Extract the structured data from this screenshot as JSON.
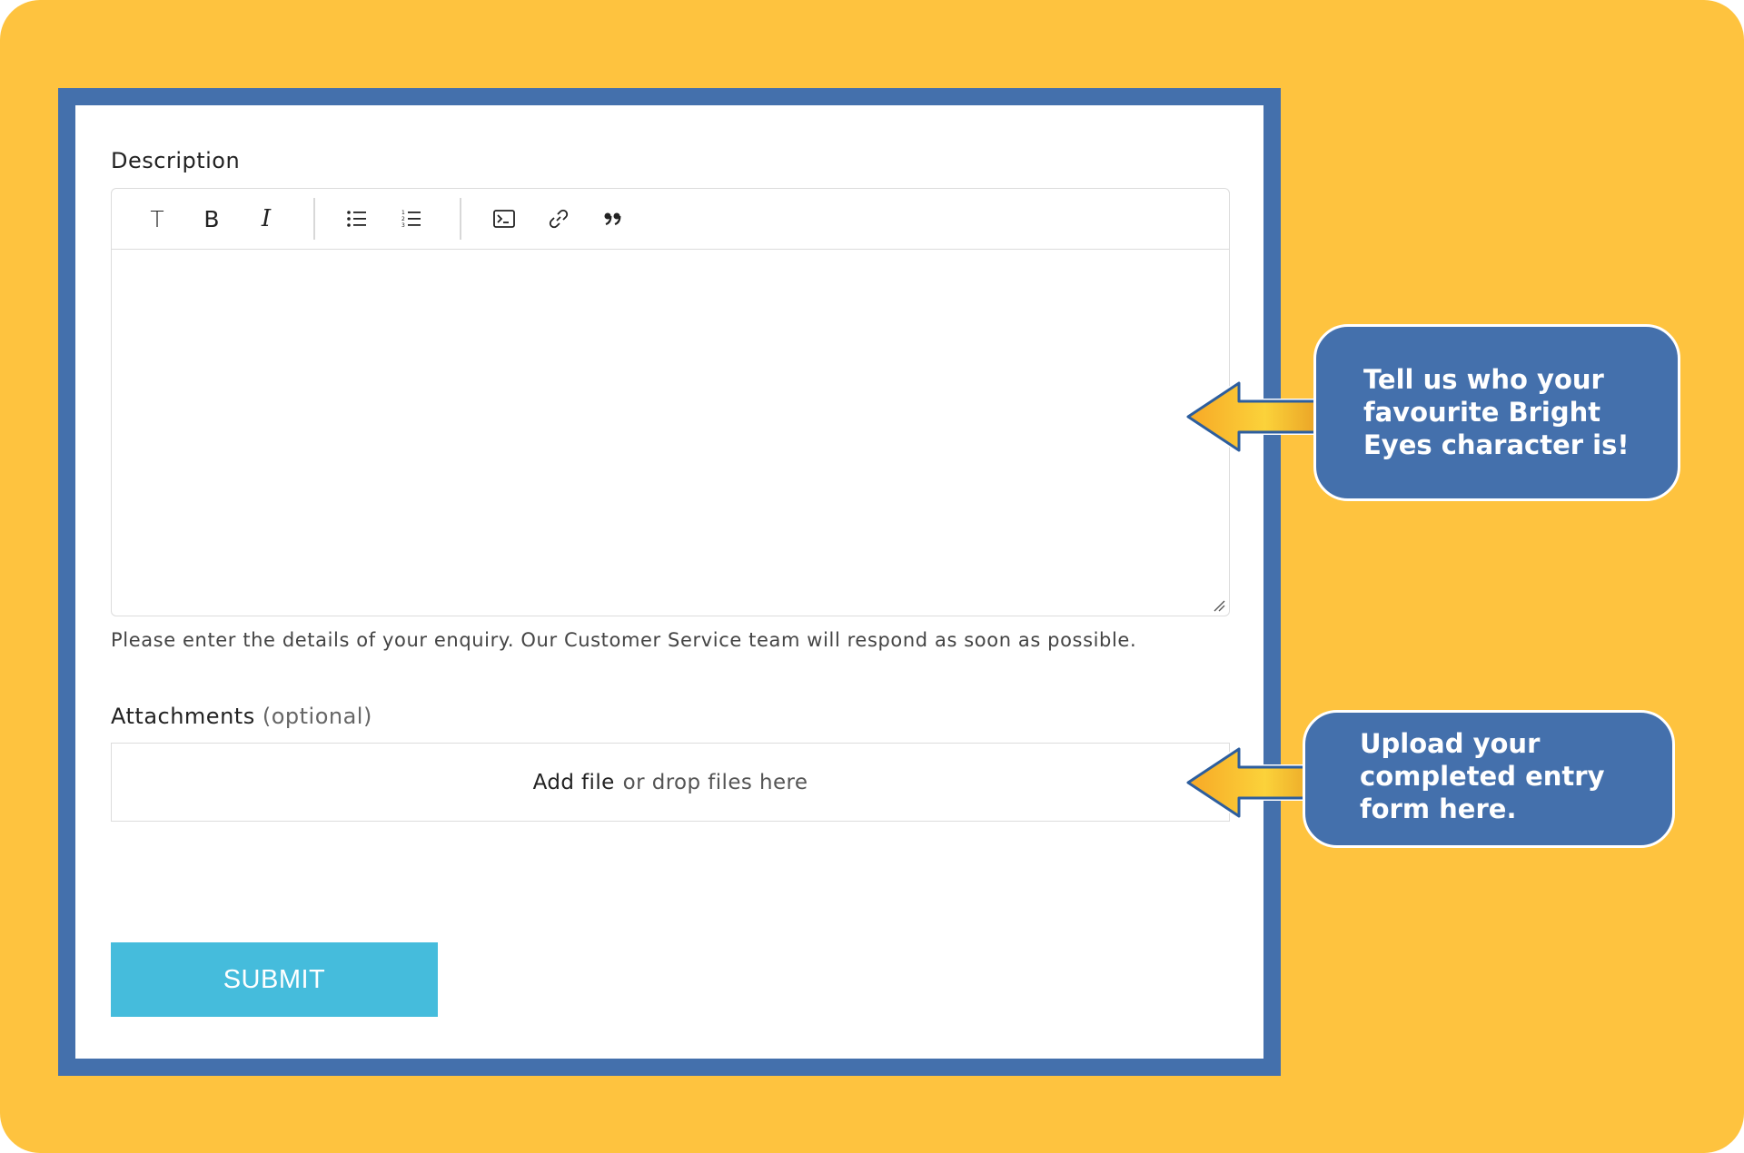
{
  "form": {
    "description_label": "Description",
    "help_text": "Please enter the details of your enquiry. Our Customer Service team will respond as soon as possible.",
    "attachments_label": "Attachments",
    "attachments_optional": "(optional)",
    "dropzone_add_file": "Add file",
    "dropzone_rest": "or drop files here",
    "submit_label": "SUBMIT"
  },
  "toolbar": {
    "items": [
      {
        "icon": "text-style-icon",
        "glyph": "T"
      },
      {
        "icon": "bold-icon",
        "glyph": "B"
      },
      {
        "icon": "italic-icon",
        "glyph": "I"
      },
      {
        "icon": "bulleted-list-icon"
      },
      {
        "icon": "numbered-list-icon"
      },
      {
        "icon": "code-block-icon"
      },
      {
        "icon": "link-icon"
      },
      {
        "icon": "quote-icon"
      }
    ]
  },
  "callouts": [
    {
      "text": "Tell us who your favourite Bright Eyes character is!"
    },
    {
      "text": "Upload your completed entry form here."
    }
  ],
  "colors": {
    "background": "#FEC33F",
    "frame": "#4470AC",
    "submit": "#45BCDC",
    "callout": "#4470AC"
  }
}
